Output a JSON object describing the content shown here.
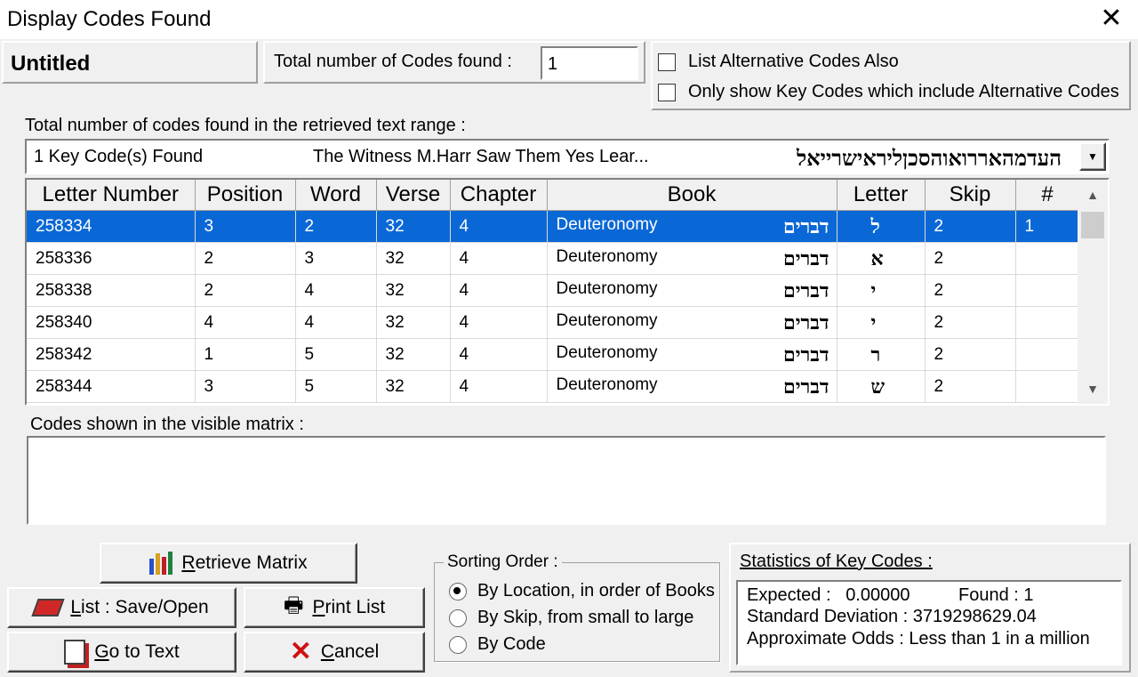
{
  "window": {
    "title": "Display Codes Found",
    "close_glyph": "✕"
  },
  "header": {
    "doc_name": "Untitled",
    "total_label": "Total number of Codes found :",
    "total_value": "1",
    "alt_codes_label": "List Alternative Codes Also",
    "key_codes_label": "Only show Key Codes which include Alternative Codes"
  },
  "range": {
    "label": "Total number of codes found in the retrieved text range  :",
    "selected_count": "1 Key Code(s) Found",
    "selected_text": "The Witness M.Harr Saw Them Yes Lear...",
    "selected_hebrew": "העדמהאררואוהסכןליראישרייאל"
  },
  "table": {
    "columns": [
      "Letter Number",
      "Position",
      "Word",
      "Verse",
      "Chapter",
      "Book",
      "Letter",
      "Skip",
      "#"
    ],
    "rows": [
      {
        "letter_number": "258334",
        "position": "3",
        "word": "2",
        "verse": "32",
        "chapter": "4",
        "book": "Deuteronomy",
        "book_hebrew": "דברים",
        "letter": "ל",
        "skip": "2",
        "num": "1"
      },
      {
        "letter_number": "258336",
        "position": "2",
        "word": "3",
        "verse": "32",
        "chapter": "4",
        "book": "Deuteronomy",
        "book_hebrew": "דברים",
        "letter": "א",
        "skip": "2",
        "num": ""
      },
      {
        "letter_number": "258338",
        "position": "2",
        "word": "4",
        "verse": "32",
        "chapter": "4",
        "book": "Deuteronomy",
        "book_hebrew": "דברים",
        "letter": "י",
        "skip": "2",
        "num": ""
      },
      {
        "letter_number": "258340",
        "position": "4",
        "word": "4",
        "verse": "32",
        "chapter": "4",
        "book": "Deuteronomy",
        "book_hebrew": "דברים",
        "letter": "י",
        "skip": "2",
        "num": ""
      },
      {
        "letter_number": "258342",
        "position": "1",
        "word": "5",
        "verse": "32",
        "chapter": "4",
        "book": "Deuteronomy",
        "book_hebrew": "דברים",
        "letter": "ר",
        "skip": "2",
        "num": ""
      },
      {
        "letter_number": "258344",
        "position": "3",
        "word": "5",
        "verse": "32",
        "chapter": "4",
        "book": "Deuteronomy",
        "book_hebrew": "דברים",
        "letter": "ש",
        "skip": "2",
        "num": ""
      }
    ]
  },
  "matrix": {
    "label": "Codes shown in the visible matrix :"
  },
  "buttons": {
    "retrieve_key": "R",
    "retrieve_rest": "etrieve Matrix",
    "list_key": "L",
    "list_rest": "ist : Save/Open",
    "print_key": "P",
    "print_rest": "rint List",
    "goto_key": "G",
    "goto_rest": "o to Text",
    "cancel_key": "C",
    "cancel_rest": "ancel"
  },
  "sorting": {
    "legend": "Sorting Order :",
    "options": [
      "By Location, in order of Books",
      "By Skip, from small to large",
      "By Code"
    ],
    "selected": "By Location, in order of Books"
  },
  "statistics": {
    "legend": "Statistics of Key Codes :",
    "expected_label": "Expected :",
    "expected_value": "0.00000",
    "found_label": "Found :",
    "found_value": "1",
    "stddev_label": "Standard Deviation :",
    "stddev_value": "3719298629.04",
    "odds_label": "Approximate Odds :",
    "odds_value": "Less than 1 in a million"
  },
  "colors": {
    "selection": "#0a68d6",
    "cancel_x": "#d01010"
  }
}
